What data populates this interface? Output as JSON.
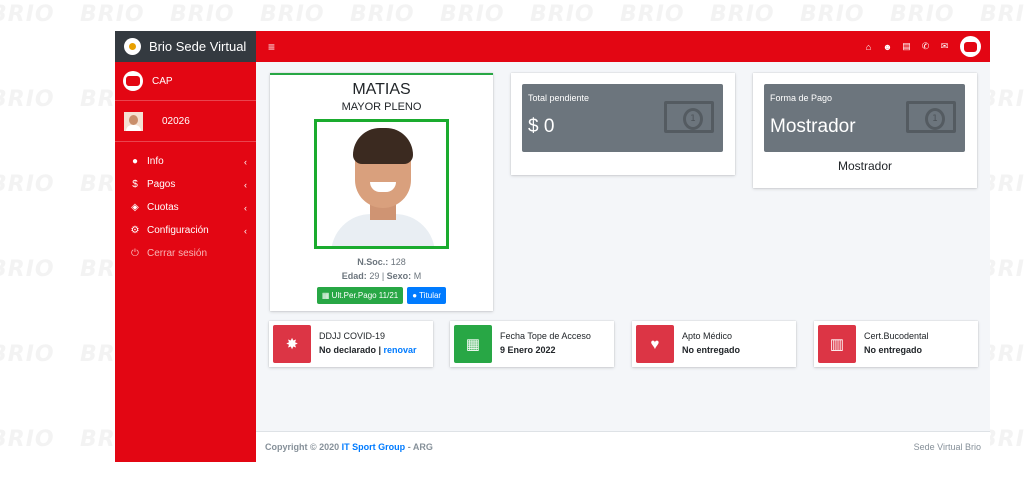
{
  "brand": {
    "name": "Brio Sede Virtual"
  },
  "sidebar": {
    "club_name": "CAP",
    "user_number": "02026",
    "items": [
      {
        "label": "Info",
        "icon": "info-circle-icon",
        "chevron": "‹"
      },
      {
        "label": "Pagos",
        "icon": "dollar-icon",
        "chevron": "‹"
      },
      {
        "label": "Cuotas",
        "icon": "layers-icon",
        "chevron": "‹"
      },
      {
        "label": "Configuración",
        "icon": "gears-icon",
        "chevron": "‹"
      },
      {
        "label": "Cerrar sesión",
        "icon": "power-icon"
      }
    ]
  },
  "topbar": {
    "menu_icon": "≡",
    "icons": [
      "home-icon",
      "users-icon",
      "file-icon",
      "whatsapp-icon",
      "comments-icon"
    ]
  },
  "profile": {
    "name": "MATIAS",
    "category": "MAYOR PLENO",
    "nsoc_label": "N.Soc.:",
    "nsoc_value": "128",
    "edad_label": "Edad:",
    "edad_value": "29",
    "sexo_label": "Sexo:",
    "sexo_value": "M",
    "btn_payment": "Ult.Per.Pago  11/21",
    "btn_holder": "Titular"
  },
  "cards": {
    "pending": {
      "title": "Total pendiente",
      "value": "$ 0"
    },
    "payment": {
      "title": "Forma de Pago",
      "value": "Mostrador",
      "footer": "Mostrador"
    }
  },
  "info_boxes": [
    {
      "label": "DDJJ COVID-19",
      "value": "No declarado",
      "separator": " | ",
      "link": "renovar",
      "icon": "virus-icon",
      "color": "#dc3545"
    },
    {
      "label": "Fecha Tope de Acceso",
      "value": "9 Enero 2022",
      "icon": "calendar-icon",
      "color": "#28a745"
    },
    {
      "label": "Apto Médico",
      "value": "No entregado",
      "icon": "heartbeat-icon",
      "color": "#dc3545"
    },
    {
      "label": "Cert.Bucodental",
      "value": "No entregado",
      "icon": "teeth-icon",
      "color": "#dc3545"
    }
  ],
  "footer": {
    "copyright": "Copyright © 2020",
    "company": "IT Sport Group",
    "suffix": "- ARG",
    "right": "Sede Virtual Brio"
  },
  "colors": {
    "primary": "#e30613",
    "dark": "#343a40",
    "card_grey": "#6c757d",
    "success": "#28a745",
    "link": "#007bff"
  }
}
